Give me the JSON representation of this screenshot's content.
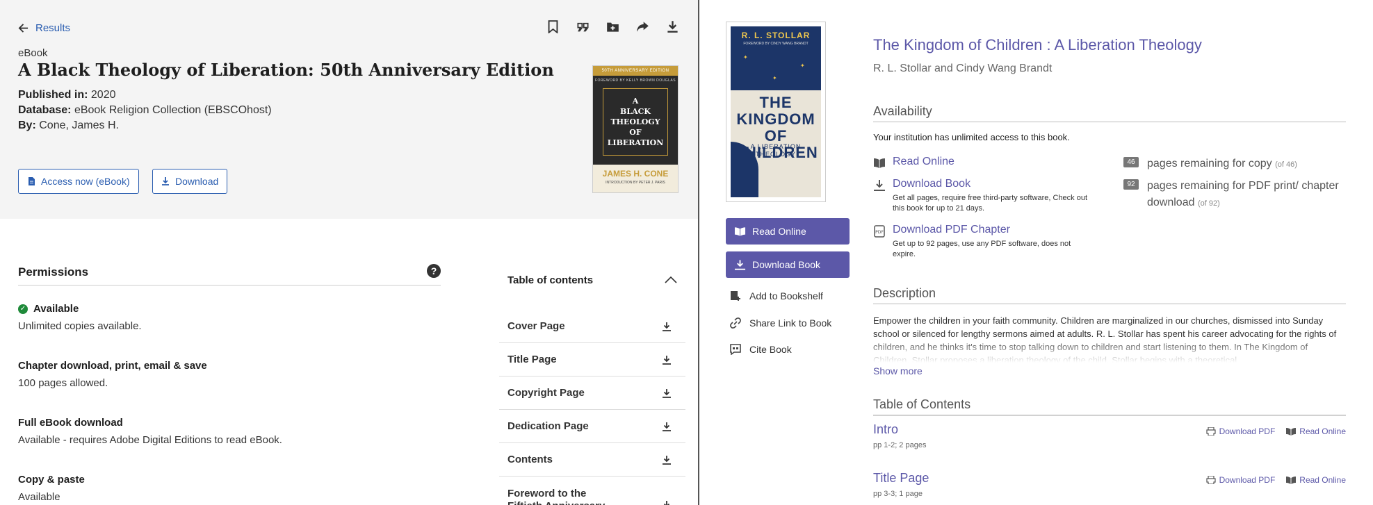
{
  "left": {
    "back_label": "Results",
    "toolbar_icons": [
      "bookmark-icon",
      "quote-icon",
      "folder-add-icon",
      "share-icon",
      "download-icon"
    ],
    "type_label": "eBook",
    "title": "A Black Theology of Liberation: 50th Anniversary Edition",
    "meta": {
      "published_label": "Published in:",
      "published_value": "2020",
      "database_label": "Database:",
      "database_value": "eBook Religion Collection (EBSCOhost)",
      "by_label": "By:",
      "by_value": "Cone, James H."
    },
    "cover": {
      "band": "50TH ANNIVERSARY EDITION",
      "foreword": "FOREWORD BY KELLY BROWN DOUGLAS",
      "title_lines": [
        "A",
        "BLACK",
        "THEOLOGY",
        "OF",
        "LIBERATION"
      ],
      "author": "JAMES H. CONE",
      "intro": "INTRODUCTION BY PETER J. PARIS"
    },
    "access_button": "Access now (eBook)",
    "download_button": "Download",
    "permissions": {
      "heading": "Permissions",
      "help": "?",
      "items": [
        {
          "title": "Available",
          "value": "Unlimited copies available."
        },
        {
          "title": "Chapter download, print, email & save",
          "value": "100 pages allowed."
        },
        {
          "title": "Full eBook download",
          "value": "Available - requires Adobe Digital Editions to read eBook."
        },
        {
          "title": "Copy & paste",
          "value": "Available"
        }
      ]
    },
    "toc": {
      "heading": "Table of contents",
      "items": [
        "Cover Page",
        "Title Page",
        "Copyright Page",
        "Dedication Page",
        "Contents",
        "Foreword to the Fiftieth Anniversary"
      ]
    }
  },
  "right": {
    "cover": {
      "author": "R. L. STOLLAR",
      "foreword": "FOREWORD BY CINDY WANG BRANDT",
      "title_lines": [
        "THE",
        "KINGDOM OF",
        "CHILDREN"
      ],
      "subtitle_lines": [
        "A LIBERATION",
        "THEOLOGY"
      ]
    },
    "read_online_button": "Read Online",
    "download_book_button": "Download Book",
    "side_links": [
      "Add to Bookshelf",
      "Share Link to Book",
      "Cite Book"
    ],
    "title": "The Kingdom of Children : A Liberation Theology",
    "authors": "R. L. Stollar and Cindy Wang Brandt",
    "availability": {
      "heading": "Availability",
      "note": "Your institution has unlimited access to this book.",
      "options": [
        {
          "label": "Read Online",
          "sub": ""
        },
        {
          "label": "Download Book",
          "sub": "Get all pages, require free third-party software, Check out this book for up to 21 days."
        },
        {
          "label": "Download PDF Chapter",
          "sub": "Get up to 92 pages, use any PDF software, does not expire."
        }
      ],
      "counts": [
        {
          "badge": "46",
          "text": "pages remaining for copy",
          "of": "(of 46)"
        },
        {
          "badge": "92",
          "text": "pages remaining for PDF print/ chapter download",
          "of": "(of 92)"
        }
      ]
    },
    "description": {
      "heading": "Description",
      "text": "Empower the children in your faith community. Children are marginalized in our churches, dismissed into Sunday school or silenced for lengthy sermons aimed at adults. R. L. Stollar has spent his career advocating for the rights of children, and he thinks it's time to stop talking down to children and start listening to them. In The Kingdom of Children, Stollar proposes a liberation theology of the child. Stollar begins with a theoretical",
      "show_more": "Show more"
    },
    "toc": {
      "heading": "Table of Contents",
      "download_pdf": "Download PDF",
      "read_online": "Read Online",
      "items": [
        {
          "name": "Intro",
          "pages": "pp 1-2; 2 pages"
        },
        {
          "name": "Title Page",
          "pages": "pp 3-3; 1 page"
        }
      ]
    }
  }
}
